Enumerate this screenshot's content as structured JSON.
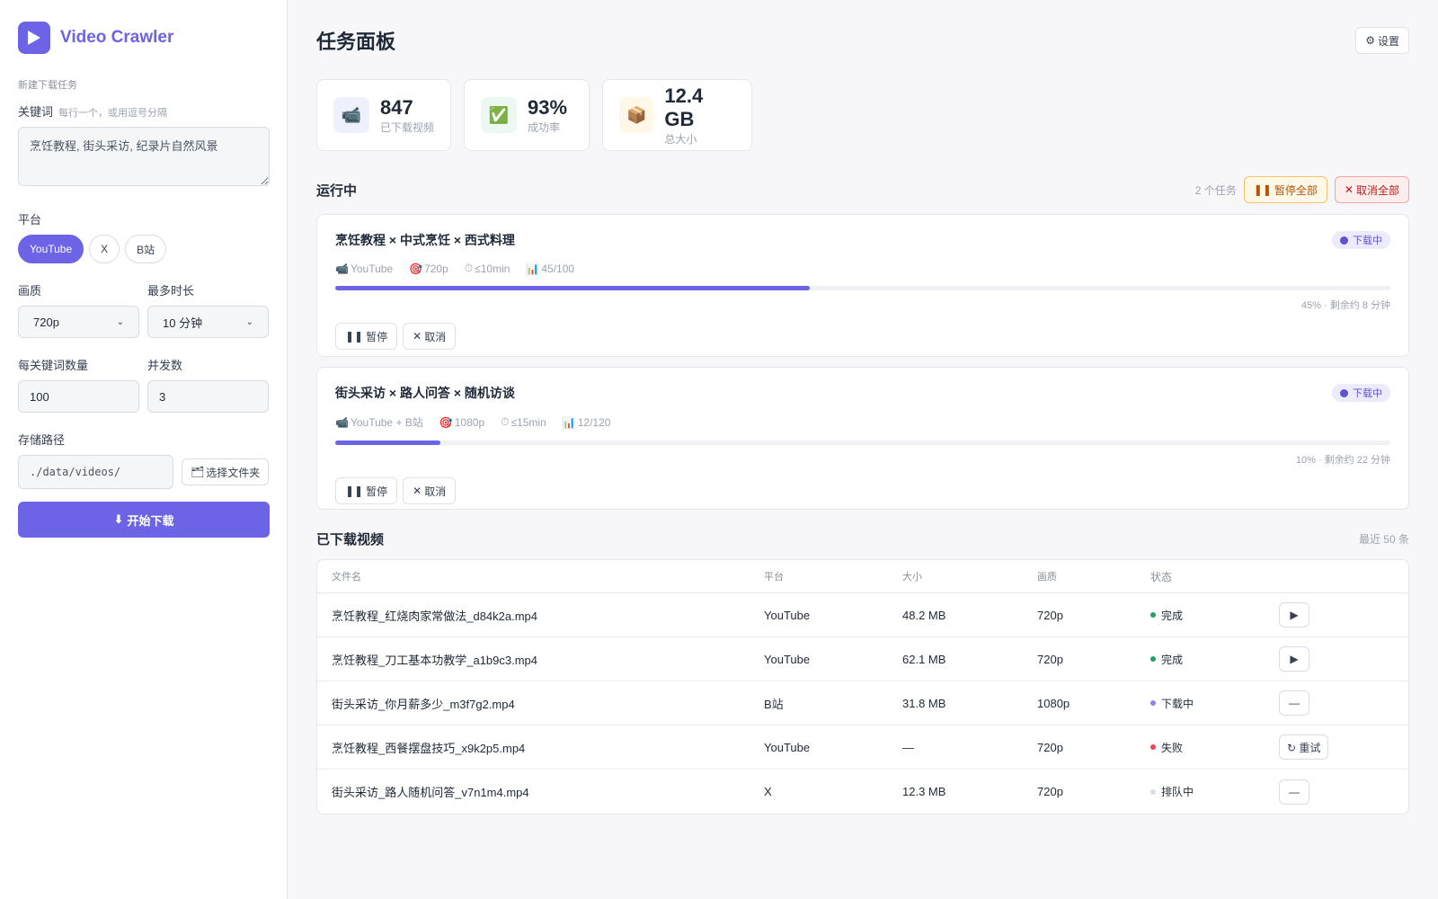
{
  "brand": {
    "name": "Video Crawler"
  },
  "sidebar": {
    "caption": "新建下载任务",
    "keywords": {
      "label": "关键词",
      "hint": "每行一个，或用逗号分隔",
      "value": "烹饪教程, 街头采访, 纪录片自然风景"
    },
    "platform": {
      "label": "平台",
      "options": [
        "YouTube",
        "X",
        "B站"
      ],
      "selected": "YouTube"
    },
    "quality": {
      "label": "画质",
      "value": "720p"
    },
    "max_duration": {
      "label": "最多时长",
      "value": "10 分钟"
    },
    "per_keyword": {
      "label": "每关键词数量",
      "value": "100"
    },
    "concurrency": {
      "label": "并发数",
      "value": "3"
    },
    "storage": {
      "label": "存储路径",
      "value": "./data/videos/",
      "choose_label": "选择文件夹"
    },
    "start_label": "开始下载"
  },
  "header": {
    "title": "任务面板",
    "settings_label": "设置"
  },
  "stats": [
    {
      "icon": "camera-icon",
      "value": "847",
      "label": "已下载视频",
      "bg": "#eef0fb"
    },
    {
      "icon": "check-icon",
      "value": "93%",
      "label": "成功率",
      "bg": "#ecf8f1"
    },
    {
      "icon": "package-icon",
      "value": "12.4 GB",
      "label": "总大小",
      "bg": "#fff7e8"
    }
  ],
  "running": {
    "title": "运行中",
    "count_label": "2 个任务",
    "pause_all_label": "暂停全部",
    "cancel_all_label": "取消全部",
    "tasks": [
      {
        "title": "烹饪教程 × 中式烹饪 × 西式料理",
        "badge": "下载中",
        "platform": "YouTube",
        "quality": "720p",
        "duration": "≤10min",
        "count": "45/100",
        "progress": 0.45,
        "progress_text": "45% · 剩余约 8 分钟",
        "pause_label": "暂停",
        "cancel_label": "取消"
      },
      {
        "title": "街头采访 × 路人问答 × 随机访谈",
        "badge": "下载中",
        "platform": "YouTube + B站",
        "quality": "1080p",
        "duration": "≤15min",
        "count": "12/120",
        "progress": 0.1,
        "progress_text": "10% · 剩余约 22 分钟",
        "pause_label": "暂停",
        "cancel_label": "取消"
      }
    ]
  },
  "downloads": {
    "title": "已下载视频",
    "recent_label": "最近 50 条",
    "columns": [
      "文件名",
      "平台",
      "大小",
      "画质",
      "状态"
    ],
    "rows": [
      {
        "name": "烹饪教程_红烧肉家常做法_d84k2a.mp4",
        "platform": "YouTube",
        "size": "48.2 MB",
        "quality": "720p",
        "status": "完成",
        "status_color": "#22a06b",
        "action": "play",
        "action_label": "▶"
      },
      {
        "name": "烹饪教程_刀工基本功教学_a1b9c3.mp4",
        "platform": "YouTube",
        "size": "62.1 MB",
        "quality": "720p",
        "status": "完成",
        "status_color": "#22a06b",
        "action": "play",
        "action_label": "▶"
      },
      {
        "name": "街头采访_你月薪多少_m3f7g2.mp4",
        "platform": "B站",
        "size": "31.8 MB",
        "quality": "1080p",
        "status": "下载中",
        "status_color": "#8b85ea",
        "action": "none",
        "action_label": "—"
      },
      {
        "name": "烹饪教程_西餐摆盘技巧_x9k2p5.mp4",
        "platform": "YouTube",
        "size": "—",
        "quality": "720p",
        "status": "失败",
        "status_color": "#e5484d",
        "action": "retry",
        "action_label": "↻ 重试"
      },
      {
        "name": "街头采访_路人随机问答_v7n1m4.mp4",
        "platform": "X",
        "size": "12.3 MB",
        "quality": "720p",
        "status": "排队中",
        "status_color": "#d9dce2",
        "action": "none",
        "action_label": "—"
      }
    ]
  }
}
